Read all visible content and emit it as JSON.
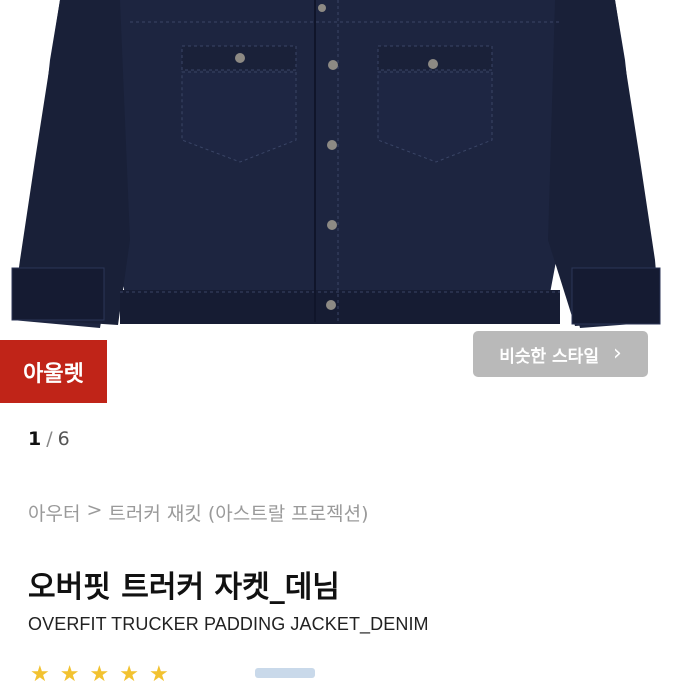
{
  "product_image": {
    "alt": "오버핏 트러커 자켓_데님",
    "colors": {
      "denim": "#1d2540",
      "denim_dark": "#141a30",
      "stitch": "#3a4566",
      "button": "#8d8a84",
      "background": "#ffffff"
    }
  },
  "badge": {
    "label": "아울렛",
    "color": "#c02418"
  },
  "similar_style_button": {
    "label": "비슷한 스타일",
    "icon": "chevron-right-icon"
  },
  "pager": {
    "current": "1",
    "separator": "/",
    "total": "6"
  },
  "breadcrumb": {
    "category": "아우터",
    "separator": ">",
    "subcategory": "트러커 재킷 (아스트랄 프로젝션)"
  },
  "product": {
    "title_ko": "오버핏 트러커 자켓_데님",
    "title_en": "OVERFIT TRUCKER PADDING JACKET_DENIM"
  },
  "rating": {
    "stars": 5,
    "icon": "star-icon"
  }
}
